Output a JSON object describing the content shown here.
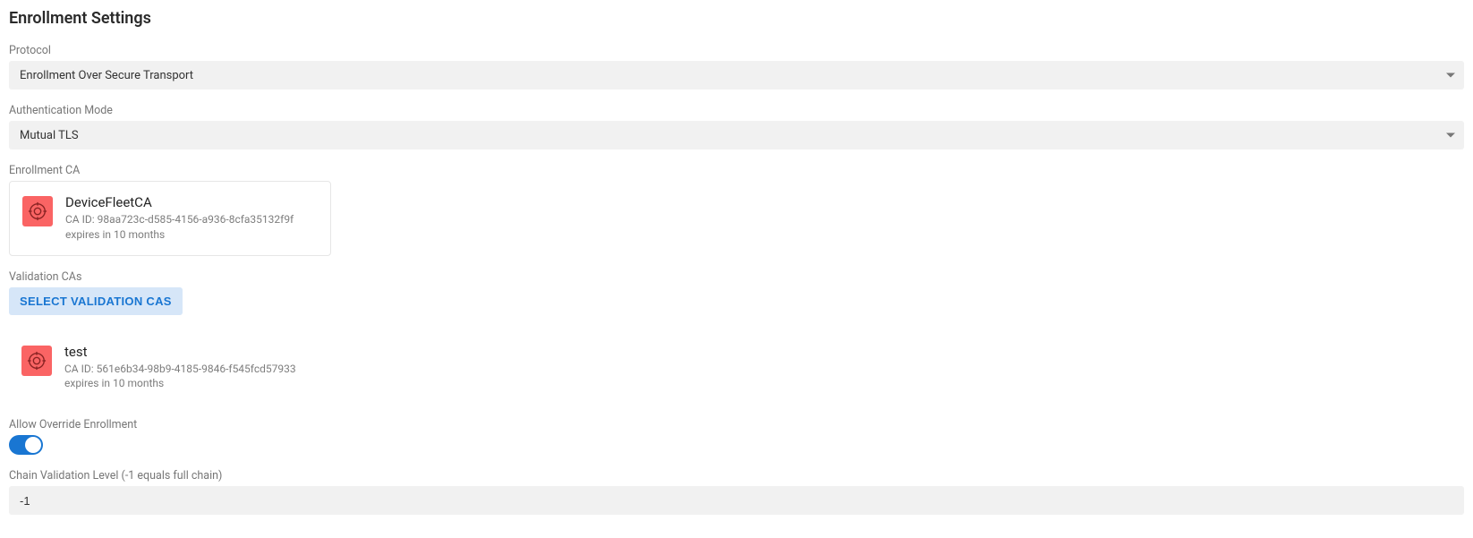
{
  "page": {
    "title": "Enrollment Settings"
  },
  "protocol": {
    "label": "Protocol",
    "value": "Enrollment Over Secure Transport"
  },
  "authMode": {
    "label": "Authentication Mode",
    "value": "Mutual TLS"
  },
  "enrollmentCA": {
    "label": "Enrollment CA",
    "name": "DeviceFleetCA",
    "id_line": "CA ID: 98aa723c-d585-4156-a936-8cfa35132f9f",
    "expires": "expires in 10 months"
  },
  "validationCAs": {
    "label": "Validation CAs",
    "button": "SELECT VALIDATION CAS",
    "items": [
      {
        "name": "test",
        "id_line": "CA ID: 561e6b34-98b9-4185-9846-f545fcd57933",
        "expires": "expires in 10 months"
      }
    ]
  },
  "override": {
    "label": "Allow Override Enrollment",
    "value": true
  },
  "chainLevel": {
    "label": "Chain Validation Level (-1 equals full chain)",
    "value": "-1"
  }
}
